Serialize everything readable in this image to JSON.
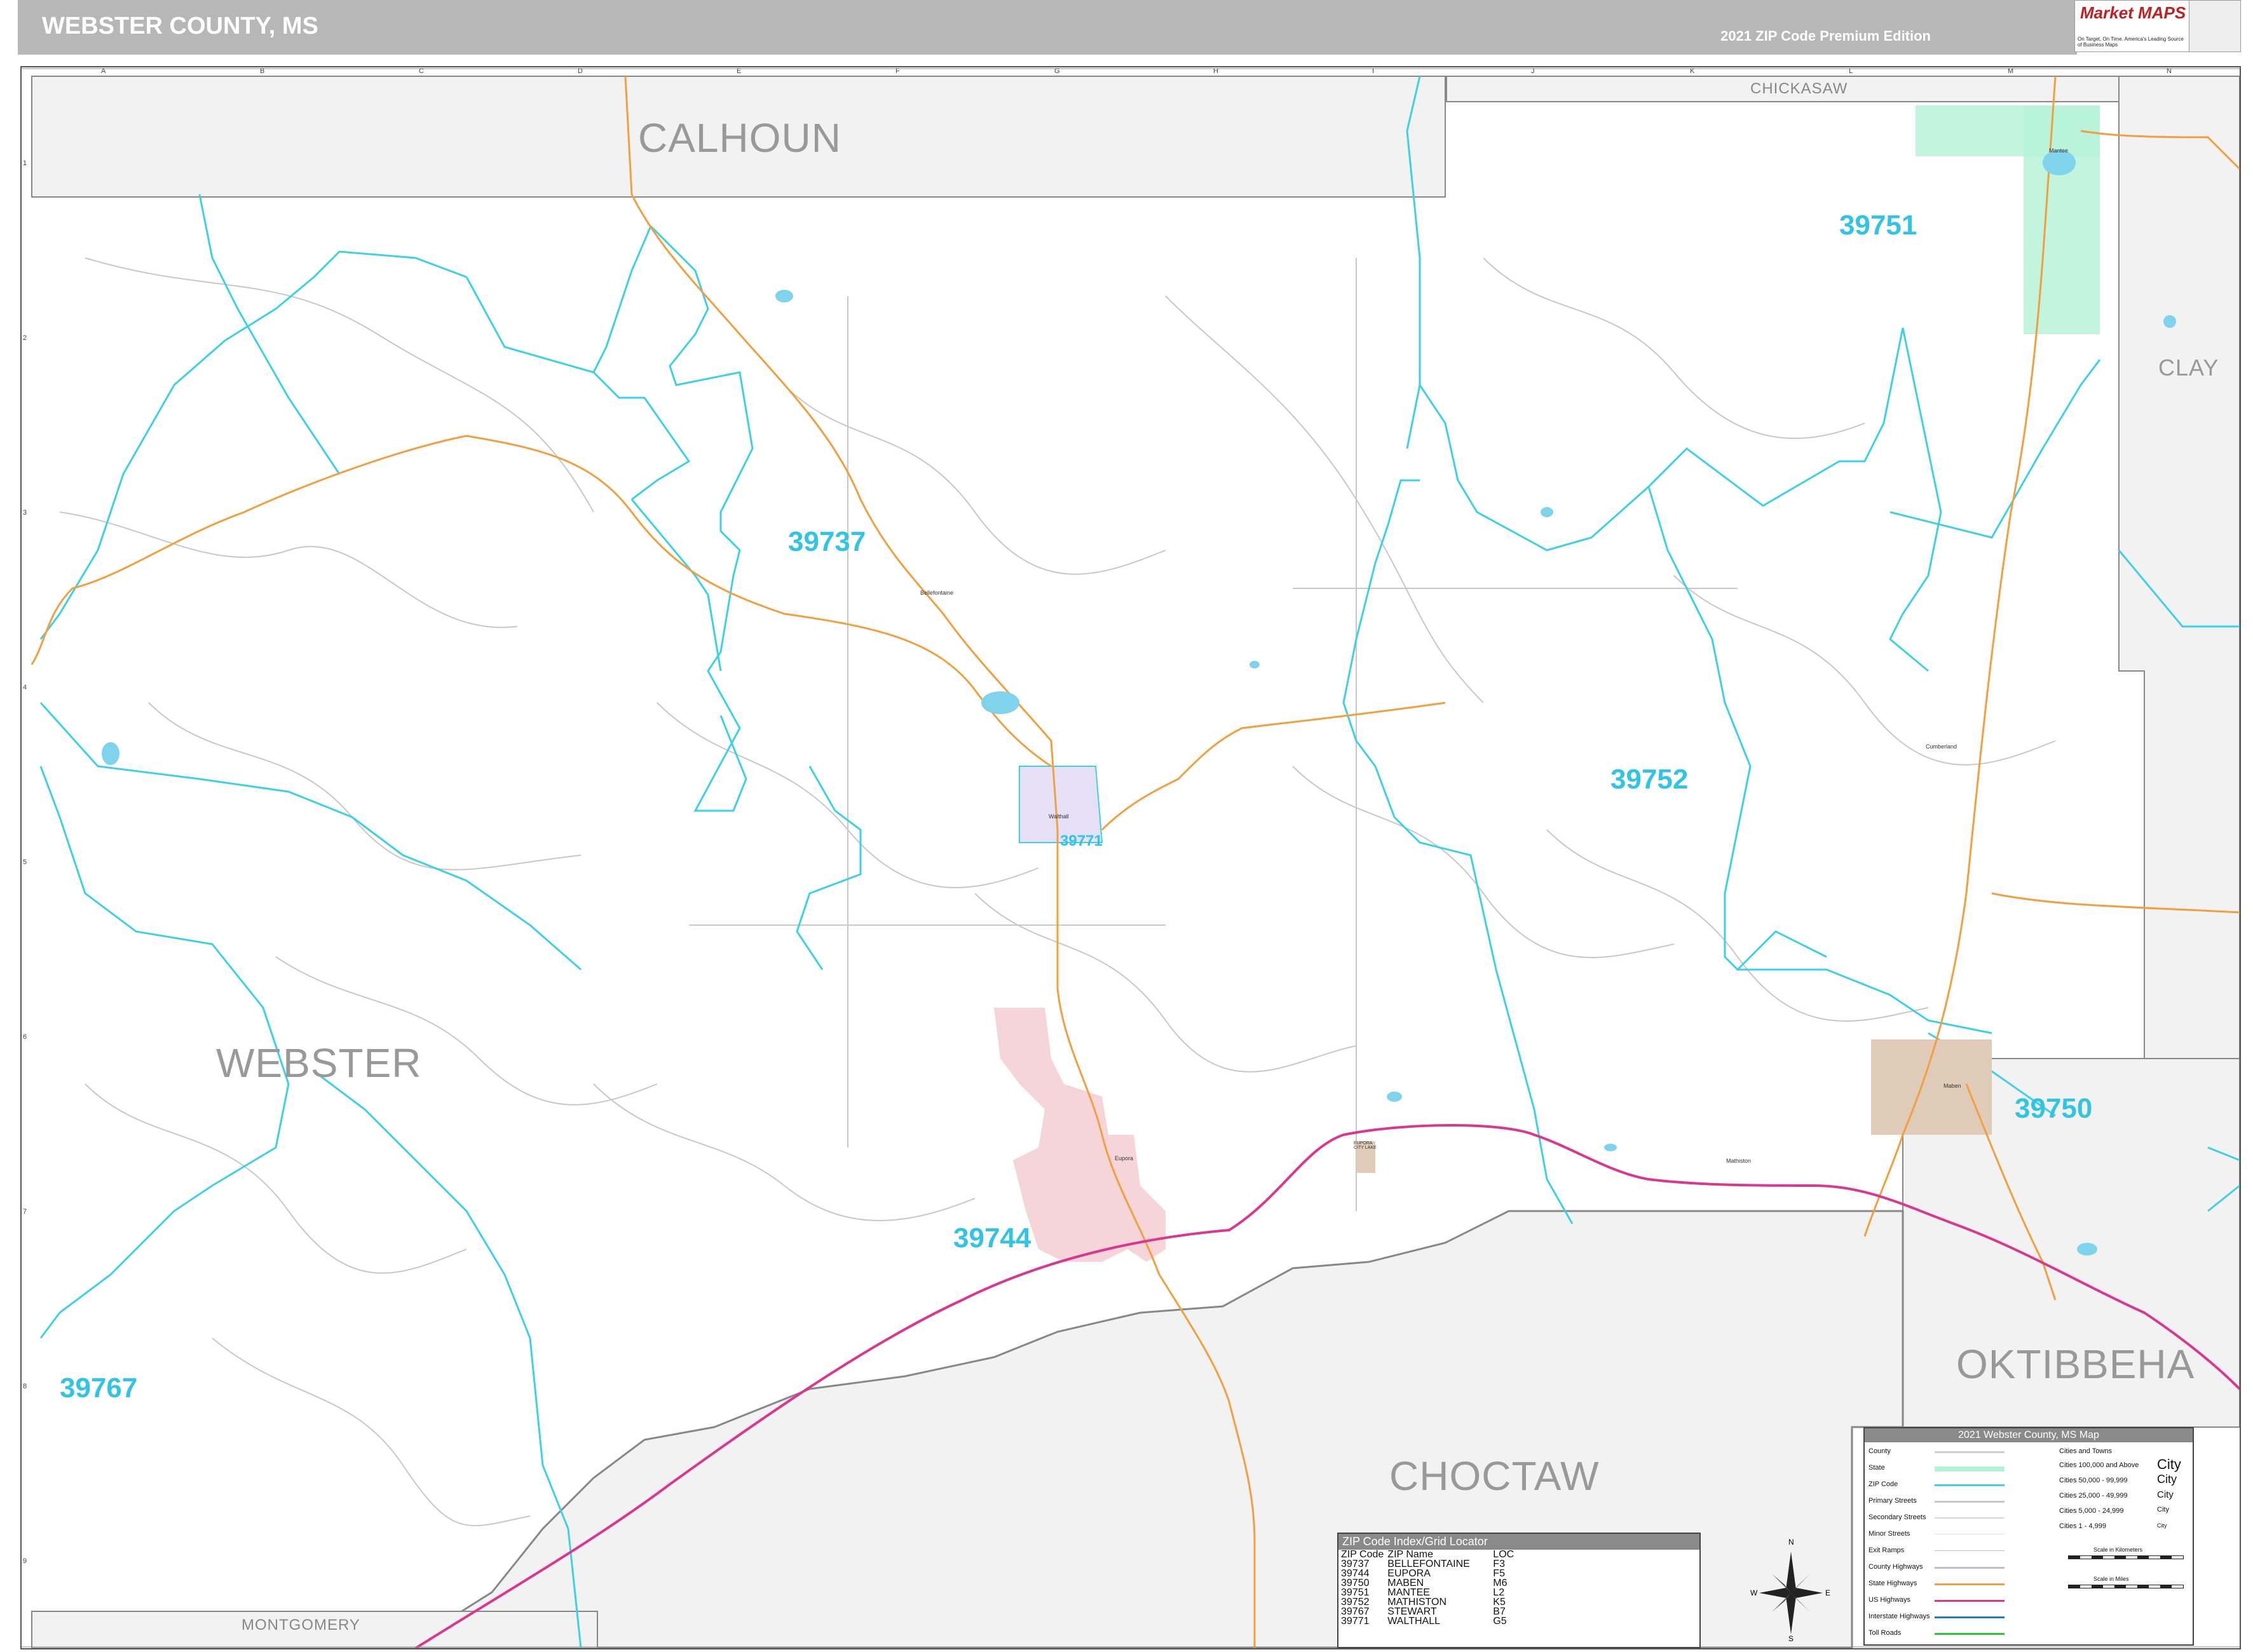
{
  "header": {
    "title": "WEBSTER COUNTY, MS",
    "edition": "2021 ZIP Code Premium Edition",
    "logo_text": "Market MAPS",
    "logo_tagline": "On Target, On Time. America's Leading Source of Business Maps"
  },
  "grid": {
    "letters": [
      "A",
      "B",
      "C",
      "D",
      "E",
      "F",
      "G",
      "H",
      "I",
      "J",
      "K",
      "L",
      "M",
      "N"
    ],
    "numbers": [
      "1",
      "2",
      "3",
      "4",
      "5",
      "6",
      "7",
      "8",
      "9"
    ]
  },
  "counties": {
    "calhoun": "CALHOUN",
    "chickasaw": "CHICKASAW",
    "clay": "CLAY",
    "webster": "WEBSTER",
    "oktibbeha": "OKTIBBEHA",
    "choctaw": "CHOCTAW",
    "montgomery": "MONTGOMERY"
  },
  "zips": {
    "z39751": "39751",
    "z39737": "39737",
    "z39752": "39752",
    "z39771": "39771",
    "z39750": "39750",
    "z39744": "39744",
    "z39767": "39767"
  },
  "places": {
    "bellefontaine": "Bellefontaine",
    "walthall": "Walthall",
    "eupora": "Eupora",
    "mantee": "Mantee",
    "cumberland": "Cumberland",
    "mathiston": "Mathiston",
    "maben": "Maben",
    "eupora_city_lake": "EUPORA CITY LAKE"
  },
  "zip_index": {
    "title": "ZIP Code Index/Grid Locator",
    "columns": [
      "ZIP Code",
      "ZIP Name",
      "LOC"
    ],
    "rows": [
      [
        "39737",
        "BELLEFONTAINE",
        "F3"
      ],
      [
        "39744",
        "EUPORA",
        "F5"
      ],
      [
        "39750",
        "MABEN",
        "M6"
      ],
      [
        "39751",
        "MANTEE",
        "L2"
      ],
      [
        "39752",
        "MATHISTON",
        "K5"
      ],
      [
        "39767",
        "STEWART",
        "B7"
      ],
      [
        "39771",
        "WALTHALL",
        "G5"
      ]
    ]
  },
  "legend": {
    "title": "2021 Webster County, MS Map",
    "items": [
      "County",
      "State",
      "ZIP Code",
      "Primary Streets",
      "Secondary Streets",
      "Minor Streets",
      "Exit Ramps",
      "County Highways",
      "State Highways",
      "US Highways",
      "Interstate Highways",
      "Toll Roads"
    ],
    "cities_title": "Cities and Towns",
    "cities": [
      "Cities 100,000 and Above",
      "Cities 50,000 - 99,999",
      "Cities 25,000 - 49,999",
      "Cities 5,000 - 24,999",
      "Cities 1 - 4,999"
    ],
    "city_symbols": [
      "City",
      "City",
      "City",
      "City",
      "City"
    ],
    "scale_km": "Scale in Kilometers",
    "scale_mi": "Scale in Miles"
  },
  "compass": {
    "n": "N",
    "s": "S",
    "e": "E",
    "w": "W"
  },
  "colors": {
    "zip_line": "#3fd0e6",
    "state_hwy": "#f0a040",
    "us_hwy": "#d8388f",
    "county_fill": "#f2f2f2",
    "eupora_fill": "#f6d5d8",
    "walthall_fill": "#e6e0f6",
    "mantee_fill": "#b7f2d8",
    "maben_fill": "#e0cab8"
  }
}
